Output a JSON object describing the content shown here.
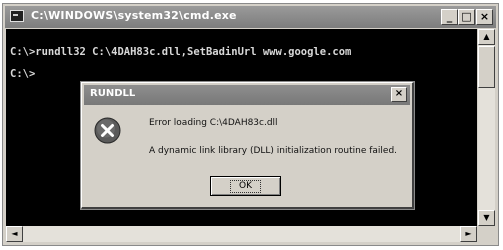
{
  "console": {
    "title": "C:\\WINDOWS\\system32\\cmd.exe",
    "buttons": {
      "minimize": "_",
      "maximize": "□",
      "close": "×"
    },
    "lines": [
      "C:\\>rundll32 C:\\4DAH83c.dll,SetBadinUrl www.google.com",
      "C:\\>"
    ],
    "scroll": {
      "up": "▲",
      "down": "▼",
      "left": "◄",
      "right": "►"
    }
  },
  "dialog": {
    "title": "RUNDLL",
    "close": "×",
    "message1": "Error loading C:\\4DAH83c.dll",
    "message2": "A dynamic link library (DLL) initialization routine failed.",
    "ok_label": "OK",
    "icon": "error-icon"
  }
}
